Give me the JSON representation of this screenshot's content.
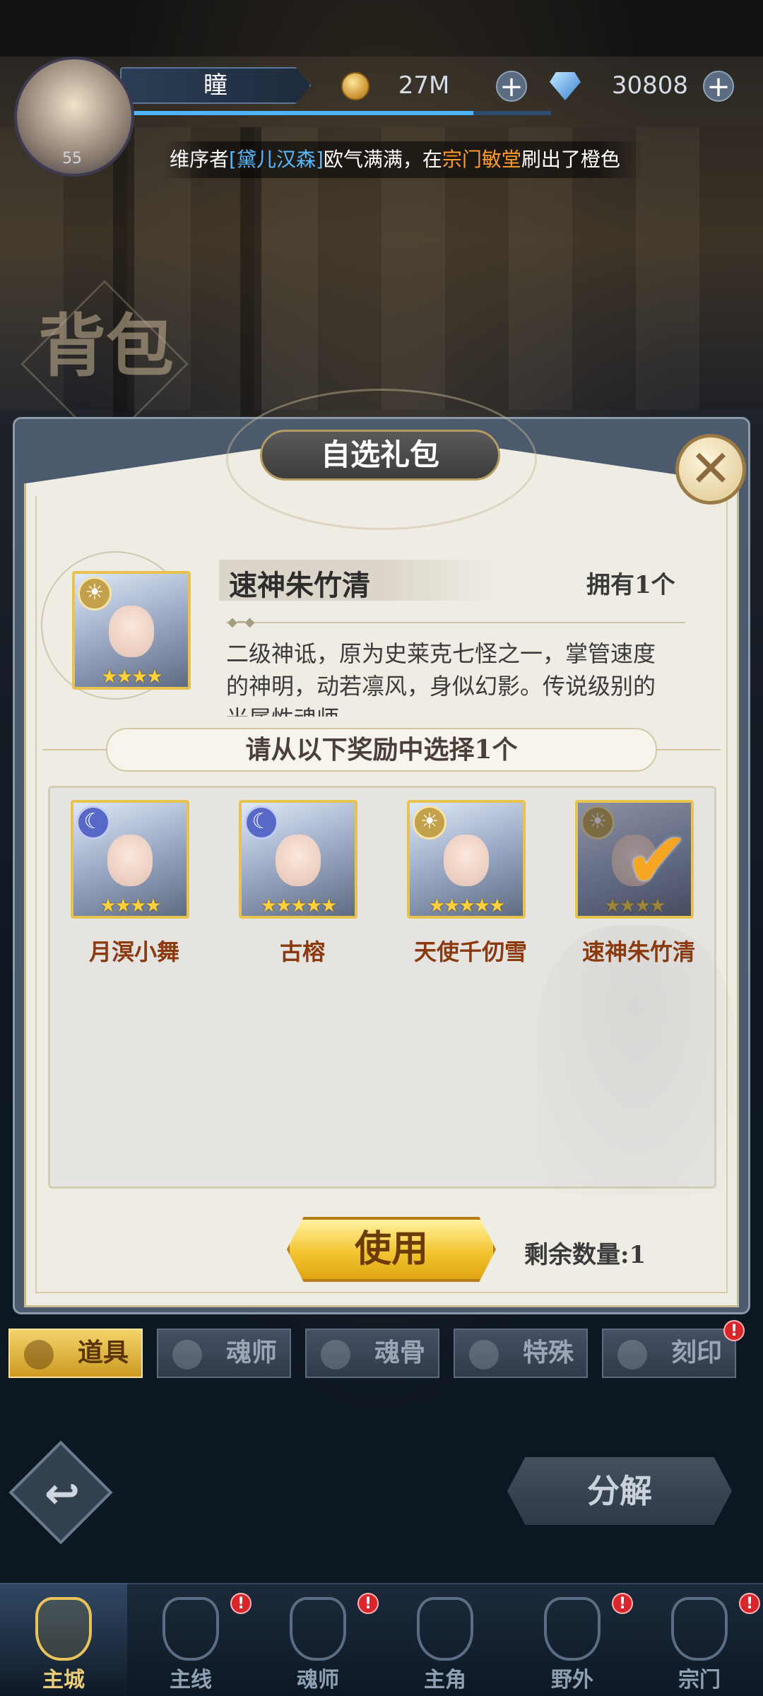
{
  "header": {
    "player_name": "瞳",
    "player_level": "55",
    "gold": "27M",
    "diamonds": "30808",
    "xp_progress": 0.82
  },
  "ticker": {
    "prefix": "维序者",
    "player": "[黛儿汉森]",
    "middle": "欧气满满，在",
    "place": "宗门敏堂",
    "suffix": "刷出了橙色"
  },
  "page": {
    "title": "背包"
  },
  "dialog": {
    "title": "自选礼包",
    "close_label": "✕",
    "hero": {
      "name": "速神朱竹清",
      "owned": "拥有1个",
      "stars": "★★★★",
      "element_icon": "sun-icon",
      "description": "二级神诋，原为史莱克七怪之一，掌管速度的神明，动若凛风，身似幻影。传说级别的光属性魂师。"
    },
    "select_prompt": "请从以下奖励中选择1个",
    "rewards": [
      {
        "name": "月溟小舞",
        "stars": "★★★★",
        "element": "moon",
        "selected": false
      },
      {
        "name": "古榕",
        "stars": "★★★★★",
        "element": "moon",
        "selected": false
      },
      {
        "name": "天使千仞雪",
        "stars": "★★★★★",
        "element": "sun",
        "selected": false
      },
      {
        "name": "速神朱竹清",
        "stars": "★★★★",
        "element": "sun",
        "selected": true
      }
    ],
    "use_label": "使用",
    "remaining": "剩余数量:1"
  },
  "tabs": [
    {
      "label": "道具",
      "active": true,
      "badge": false
    },
    {
      "label": "魂师",
      "active": false,
      "badge": false
    },
    {
      "label": "魂骨",
      "active": false,
      "badge": false
    },
    {
      "label": "特殊",
      "active": false,
      "badge": false
    },
    {
      "label": "刻印",
      "active": false,
      "badge": true
    }
  ],
  "actions": {
    "decompose_label": "分解",
    "back_icon": "↩"
  },
  "bottom_nav": [
    {
      "label": "主城",
      "active": true,
      "badge": false
    },
    {
      "label": "主线",
      "active": false,
      "badge": true
    },
    {
      "label": "魂师",
      "active": false,
      "badge": true
    },
    {
      "label": "主角",
      "active": false,
      "badge": false
    },
    {
      "label": "野外",
      "active": false,
      "badge": true
    },
    {
      "label": "宗门",
      "active": false,
      "badge": true
    }
  ],
  "badge_text": "!"
}
